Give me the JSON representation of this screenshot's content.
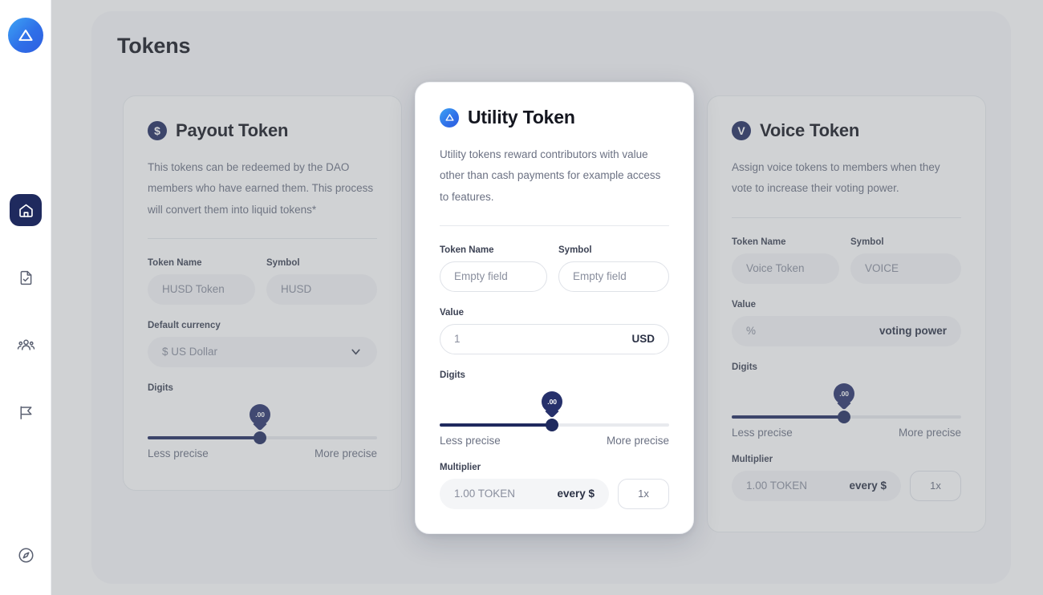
{
  "page": {
    "title": "Tokens"
  },
  "sidebar": {
    "logo": {
      "icon": "triangle-logo-icon"
    },
    "items": [
      {
        "name": "home",
        "icon": "home-icon",
        "active": true
      },
      {
        "name": "documents",
        "icon": "document-check-icon",
        "active": false
      },
      {
        "name": "members",
        "icon": "users-icon",
        "active": false
      },
      {
        "name": "proposals",
        "icon": "flag-icon",
        "active": false
      }
    ],
    "bottom": {
      "name": "explore",
      "icon": "compass-icon"
    }
  },
  "cards": [
    {
      "id": "payout-token",
      "badge_glyph": "$",
      "title": "Payout Token",
      "description": "This tokens can be redeemed  by the DAO members who have earned them. This process will convert them into liquid tokens*",
      "token_name_label": "Token Name",
      "token_name_value": "HUSD Token",
      "symbol_label": "Symbol",
      "symbol_value": "HUSD",
      "currency_label": "Default currency",
      "currency_value": "$ US Dollar",
      "digits_label": "Digits",
      "digits_bubble": ".00",
      "digits_percent": 49,
      "less_precise": "Less precise",
      "more_precise": "More precise"
    },
    {
      "id": "utility-token",
      "badge_glyph": "triangle",
      "title": "Utility Token",
      "description": "Utility tokens reward contributors with value other than cash payments for example access to features.",
      "token_name_label": "Token Name",
      "token_name_value": "Empty field",
      "symbol_label": "Symbol",
      "symbol_value": "Empty field",
      "value_label": "Value",
      "value_value": "1",
      "value_unit": "USD",
      "digits_label": "Digits",
      "digits_bubble": ".00",
      "digits_percent": 49,
      "less_precise": "Less precise",
      "more_precise": "More precise",
      "multiplier_label": "Multiplier",
      "multiplier_value": "1.00 TOKEN",
      "multiplier_unit": "every $",
      "multiplier_factor": "1x"
    },
    {
      "id": "voice-token",
      "badge_glyph": "V",
      "title": "Voice Token",
      "description": "Assign voice tokens to members when they vote to increase their voting power.",
      "token_name_label": "Token Name",
      "token_name_value": "Voice Token",
      "symbol_label": "Symbol",
      "symbol_value": "VOICE",
      "value_label": "Value",
      "value_value": "%",
      "value_unit": "voting power",
      "digits_label": "Digits",
      "digits_bubble": ".00",
      "digits_percent": 49,
      "less_precise": "Less precise",
      "more_precise": "More precise",
      "multiplier_label": "Multiplier",
      "multiplier_value": "1.00 TOKEN",
      "multiplier_unit": "every $",
      "multiplier_factor": "1x"
    }
  ],
  "colors": {
    "brand_blue": "#2f6fe8",
    "navy": "#1f2a5e",
    "page_bg": "#f7f8fa",
    "card_bg": "#ffffff",
    "text_muted": "#6b7183"
  }
}
